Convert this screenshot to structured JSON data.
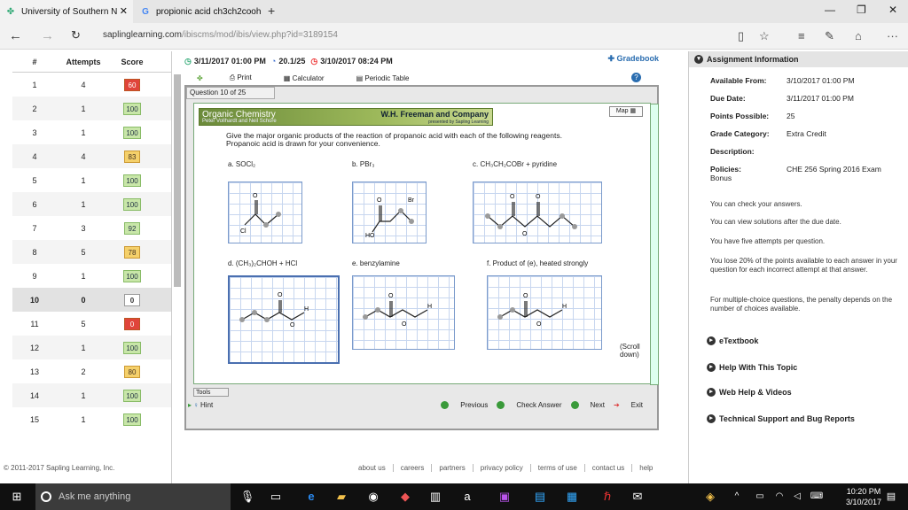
{
  "browser": {
    "tabs": [
      {
        "title": "University of Southern N"
      },
      {
        "title": "propionic acid ch3ch2cooh"
      }
    ],
    "url_host": "saplinglearning.com",
    "url_path": "/ibiscms/mod/ibis/view.php?id=3189154",
    "new_tab": "+",
    "win_min": "—",
    "win_max": "❐",
    "win_close": "✕"
  },
  "attempts_table": {
    "headers": [
      "#",
      "Attempts",
      "Score"
    ],
    "rows": [
      {
        "num": "1",
        "attempts": "4",
        "score": "60",
        "color": "red"
      },
      {
        "num": "2",
        "attempts": "1",
        "score": "100",
        "color": "green"
      },
      {
        "num": "3",
        "attempts": "1",
        "score": "100",
        "color": "green"
      },
      {
        "num": "4",
        "attempts": "4",
        "score": "83",
        "color": "yellow"
      },
      {
        "num": "5",
        "attempts": "1",
        "score": "100",
        "color": "green"
      },
      {
        "num": "6",
        "attempts": "1",
        "score": "100",
        "color": "green"
      },
      {
        "num": "7",
        "attempts": "3",
        "score": "92",
        "color": "green"
      },
      {
        "num": "8",
        "attempts": "5",
        "score": "78",
        "color": "yellow"
      },
      {
        "num": "9",
        "attempts": "1",
        "score": "100",
        "color": "green"
      },
      {
        "num": "10",
        "attempts": "0",
        "score": "0",
        "color": "white"
      },
      {
        "num": "11",
        "attempts": "5",
        "score": "0",
        "color": "red"
      },
      {
        "num": "12",
        "attempts": "1",
        "score": "100",
        "color": "green"
      },
      {
        "num": "13",
        "attempts": "2",
        "score": "80",
        "color": "yellow"
      },
      {
        "num": "14",
        "attempts": "1",
        "score": "100",
        "color": "green"
      },
      {
        "num": "15",
        "attempts": "1",
        "score": "100",
        "color": "green"
      }
    ]
  },
  "question_header": {
    "open_date": "3/11/2017 01:00 PM",
    "points": "20.1/25",
    "due_date": "3/10/2017 08:24 PM",
    "gradebook": "Gradebook"
  },
  "toolbar": {
    "print": "Print",
    "calculator": "Calculator",
    "periodic": "Periodic Table"
  },
  "question": {
    "label": "Question 10 of 25",
    "banner_title": "Organic Chemistry",
    "banner_authors": "Peter Vollhardt and Neil Schore",
    "banner_publisher": "W.H. Freeman and Company",
    "banner_presented": "presented by Sapling Learning",
    "map_button": "Map",
    "prompt_line1": "Give the major organic products of the reaction of propanoic acid with each of the following reagents.",
    "prompt_line2": "Propanoic acid is drawn for your convenience.",
    "reagents": {
      "a": "a. SOCl₂",
      "b": "b. PBr₃",
      "c": "c. CH₃CH₂COBr + pyridine",
      "d": "d. (CH₃)₂CHOH + HCl",
      "e": "e. benzylamine",
      "f": "f. Product of (e), heated strongly"
    },
    "atoms": {
      "o": "O",
      "cl": "Cl",
      "br": "Br",
      "ho": "HO",
      "h": "H"
    },
    "scroll_note": "(Scroll down)",
    "tools": "Tools",
    "hint": "Hint",
    "previous": "Previous",
    "check": "Check Answer",
    "next": "Next",
    "exit": "Exit"
  },
  "assignment": {
    "heading": "Assignment Information",
    "available_label": "Available From:",
    "available_value": "3/10/2017 01:00 PM",
    "due_label": "Due Date:",
    "due_value": "3/11/2017 01:00 PM",
    "points_label": "Points Possible:",
    "points_value": "25",
    "category_label": "Grade Category:",
    "category_value": "Extra Credit",
    "desc_label": "Description:",
    "policies_label": "Policies:",
    "bonus": "Bonus",
    "policies_value": "CHE 256 Spring 2016 Exam",
    "msg1": "You can check your answers.",
    "msg2": "You can view solutions after the due date.",
    "msg3": "You have five attempts per question.",
    "msg4": "You lose 20% of the points available to each answer in your question for each incorrect attempt at that answer.",
    "msg5": "For multiple-choice questions, the penalty depends on the number of choices available.",
    "links": [
      "eTextbook",
      "Help With This Topic",
      "Web Help & Videos",
      "Technical Support and Bug Reports"
    ]
  },
  "footer": {
    "copyright": "© 2011-2017 Sapling Learning, Inc.",
    "links": [
      "about us",
      "careers",
      "partners",
      "privacy policy",
      "terms of use",
      "contact us",
      "help"
    ]
  },
  "taskbar": {
    "search_placeholder": "Ask me anything",
    "time": "10:20 PM",
    "date": "3/10/2017"
  }
}
